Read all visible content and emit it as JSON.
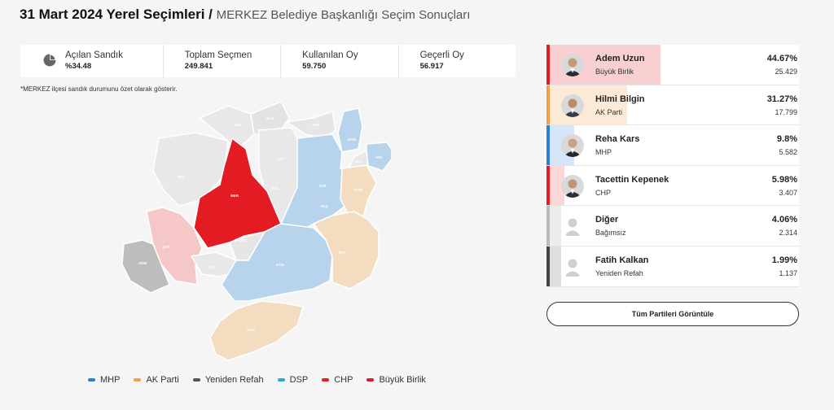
{
  "header": {
    "title_bold": "31 Mart 2024 Yerel Seçimleri /",
    "title_sub": "MERKEZ Belediye Başkanlığı Seçim Sonuçları"
  },
  "stats": [
    {
      "label": "Açılan Sandık",
      "value": "%34.48"
    },
    {
      "label": "Toplam Seçmen",
      "value": "249.841"
    },
    {
      "label": "Kullanılan Oy",
      "value": "59.750"
    },
    {
      "label": "Geçerli Oy",
      "value": "56.917"
    }
  ],
  "note": "*MERKEZ ilçesi sandık durumunu özet olarak gösterir.",
  "map_labels": [
    "MER",
    "ŞAR",
    "AKM",
    "ALT",
    "KAR",
    "ZAR",
    "DUR",
    "BAY",
    "SOĞ",
    "ORT",
    "KIZ",
    "YAL",
    "KUZ",
    "ÇAT",
    "BAŞ",
    "ARI",
    "DOĞ",
    "ULA",
    "ESE",
    "AKÇ"
  ],
  "legend": [
    {
      "label": "MHP",
      "color": "#2a7fd4"
    },
    {
      "label": "AK Parti",
      "color": "#f0a04b"
    },
    {
      "label": "Yeniden Refah",
      "color": "#555555"
    },
    {
      "label": "DSP",
      "color": "#29a8e0"
    },
    {
      "label": "CHP",
      "color": "#e31b23"
    },
    {
      "label": "Büyük Birlik",
      "color": "#d81e2c"
    }
  ],
  "candidates": [
    {
      "name": "Adem Uzun",
      "party": "Büyük Birlik",
      "pct": "44.67%",
      "share": 0.4467,
      "votes": "25.429",
      "color": "#e31b23",
      "fill": "#e9555c"
    },
    {
      "name": "Hilmi Bilgin",
      "party": "AK Parti",
      "pct": "31.27%",
      "share": 0.3127,
      "votes": "17.799",
      "color": "#f0a04b",
      "fill": "#f3b570"
    },
    {
      "name": "Reha Kars",
      "party": "MHP",
      "pct": "9.8%",
      "share": 0.098,
      "votes": "5.582",
      "color": "#2a7fd4",
      "fill": "#6aa7e5"
    },
    {
      "name": "Tacettin Kepenek",
      "party": "CHP",
      "pct": "5.98%",
      "share": 0.0598,
      "votes": "3.407",
      "color": "#e31b23",
      "fill": "#ef6f75"
    },
    {
      "name": "Diğer",
      "party": "Bağımsız",
      "pct": "4.06%",
      "share": 0.0406,
      "votes": "2.314",
      "color": "#bbbbbb",
      "fill": "#bbbbbb"
    },
    {
      "name": "Fatih Kalkan",
      "party": "Yeniden Refah",
      "pct": "1.99%",
      "share": 0.0199,
      "votes": "1.137",
      "color": "#444444",
      "fill": "#888888"
    }
  ],
  "button_label": "Tüm Partileri Görüntüle"
}
